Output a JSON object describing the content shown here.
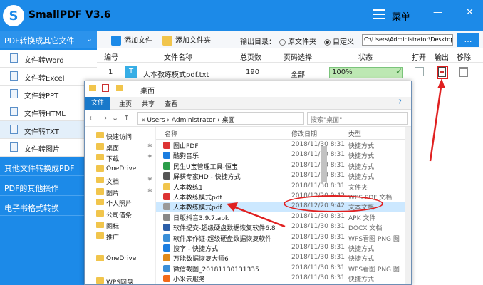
{
  "app": {
    "logo": "S",
    "title": "SmallPDF V3.6",
    "menu_label": "菜单"
  },
  "window_buttons": [
    "—",
    "✕"
  ],
  "sidebar": {
    "header": "PDF转换成其它文件",
    "header_chevron": "⌄",
    "items": [
      {
        "label": "文件转Word"
      },
      {
        "label": "文件转Excel"
      },
      {
        "label": "文件转PPT"
      },
      {
        "label": "文件转HTML"
      },
      {
        "label": "文件转TXT",
        "selected": true
      },
      {
        "label": "文件转图片"
      }
    ],
    "categories": [
      "其他文件转换成PDF",
      "PDF的其他操作",
      "电子书格式转换"
    ]
  },
  "toolbar": {
    "add_file": "添加文件",
    "add_folder": "添加文件夹",
    "output_label": "输出目录：",
    "radio_original": "原文件夹",
    "radio_custom": "自定义",
    "path": "C:\\Users\\Administrator\\Desktop",
    "browse_button": "…"
  },
  "table": {
    "headers": [
      "编号",
      "文件名称",
      "总页数",
      "页码选择",
      "状态",
      "打开",
      "输出",
      "移除"
    ],
    "row": {
      "no": "1",
      "name": "人本教练模式pdf.txt",
      "pages": "190",
      "range": "全部",
      "progress": "100%",
      "progress_value": 1.0
    }
  },
  "explorer": {
    "title": "桌面",
    "ribbon_tabs": [
      "文件",
      "主页",
      "共享",
      "查看"
    ],
    "help_icon": "?",
    "address": "« Users › Administrator › 桌面",
    "search_placeholder": "搜索\"桌面\"",
    "nav_items": [
      {
        "label": "快速访问",
        "pin": ""
      },
      {
        "label": "桌面",
        "pin": "✱"
      },
      {
        "label": "下载",
        "pin": "✱"
      },
      {
        "label": "OneDrive",
        "pin": ""
      },
      {
        "label": "文档",
        "pin": "✱"
      },
      {
        "label": "图片",
        "pin": "✱"
      },
      {
        "label": "个人照片",
        "pin": ""
      },
      {
        "label": "公司借条",
        "pin": ""
      },
      {
        "label": "图标",
        "pin": ""
      },
      {
        "label": "推广",
        "pin": ""
      },
      {
        "label": "",
        "pin": ""
      },
      {
        "label": "OneDrive",
        "pin": ""
      },
      {
        "label": "",
        "pin": ""
      },
      {
        "label": "WPS网盘",
        "pin": ""
      }
    ],
    "columns": [
      "名称",
      "修改日期",
      "类型"
    ],
    "files": [
      {
        "name": "图山PDF",
        "date": "2018/11/30 8:31",
        "type": "快捷方式",
        "color": "#d33"
      },
      {
        "name": "酷狗音乐",
        "date": "2018/11/30 8:31",
        "type": "快捷方式",
        "color": "#1a7de0"
      },
      {
        "name": "民生U宝管理工具-恒宝",
        "date": "2018/11/30 8:31",
        "type": "快捷方式",
        "color": "#2a9d4a"
      },
      {
        "name": "屏获专家HD - 快捷方式",
        "date": "2018/11/30 8:31",
        "type": "快捷方式",
        "color": "#555"
      },
      {
        "name": "人本教练1",
        "date": "2018/11/30 8:31",
        "type": "文件夹",
        "color": "#f1c54c"
      },
      {
        "name": "人本教练模式pdf",
        "date": "2018/12/20 9:42",
        "type": "WPS PDF 文档",
        "color": "#d33"
      },
      {
        "name": "人本教练模式pdf",
        "date": "2018/12/20 9:42",
        "type": "文本文档",
        "color": "#999",
        "highlight": true
      },
      {
        "name": "日版抖音3.9.7.apk",
        "date": "2018/11/30 8:31",
        "type": "APK 文件",
        "color": "#888"
      },
      {
        "name": "软件提交-超级硬盘数据恢复软件6.8",
        "date": "2018/11/30 8:31",
        "type": "DOCX 文档",
        "color": "#2b5ea8"
      },
      {
        "name": "软件库作证-超级硬盘数据恢复软件",
        "date": "2018/11/30 8:31",
        "type": "WPS看图 PNG 图",
        "color": "#3a8fd8"
      },
      {
        "name": "搜字 - 快捷方式",
        "date": "2018/11/30 8:31",
        "type": "快捷方式",
        "color": "#1a7de0"
      },
      {
        "name": "万能数据恢复大师6",
        "date": "2018/11/30 8:31",
        "type": "快捷方式",
        "color": "#e08a1a"
      },
      {
        "name": "微信截图_20181130131335",
        "date": "2018/11/30 8:31",
        "type": "WPS看图 PNG 图",
        "color": "#3a8fd8"
      },
      {
        "name": "小米云服务",
        "date": "2018/11/30 8:31",
        "type": "快捷方式",
        "color": "#f26b1a"
      }
    ]
  },
  "colors": {
    "accent": "#1c8ae8",
    "annotation": "#e02020"
  }
}
